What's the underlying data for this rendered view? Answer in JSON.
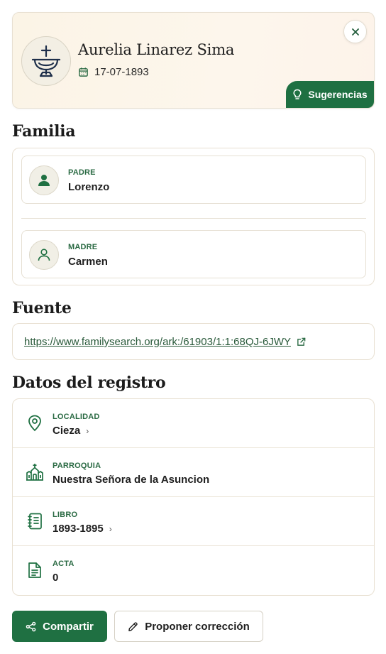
{
  "header": {
    "name": "Aurelia Linarez Sima",
    "date": "17-07-1893",
    "suggest_label": "Sugerencias",
    "close_icon": "close-icon",
    "avatar_icon": "baptism-font-icon"
  },
  "familia": {
    "title": "Familia",
    "padre": {
      "label": "PADRE",
      "value": "Lorenzo"
    },
    "madre": {
      "label": "MADRE",
      "value": "Carmen"
    }
  },
  "fuente": {
    "title": "Fuente",
    "url": "https://www.familysearch.org/ark:/61903/1:1:68QJ-6JWY"
  },
  "datos": {
    "title": "Datos del registro",
    "rows": [
      {
        "label": "LOCALIDAD",
        "value": "Cieza",
        "icon": "location-pin-icon"
      },
      {
        "label": "PARROQUIA",
        "value": "Nuestra Señora de la Asuncion",
        "icon": "church-icon"
      },
      {
        "label": "LIBRO",
        "value": "1893-1895",
        "icon": "book-icon"
      },
      {
        "label": "ACTA",
        "value": "0",
        "icon": "document-icon"
      }
    ]
  },
  "actions": {
    "share_label": "Compartir",
    "correct_label": "Proponer corrección"
  },
  "colors": {
    "accent": "#1f7042",
    "label": "#2a6a43",
    "header_bg": "#fbf4e6",
    "border": "#e8e0d2"
  }
}
